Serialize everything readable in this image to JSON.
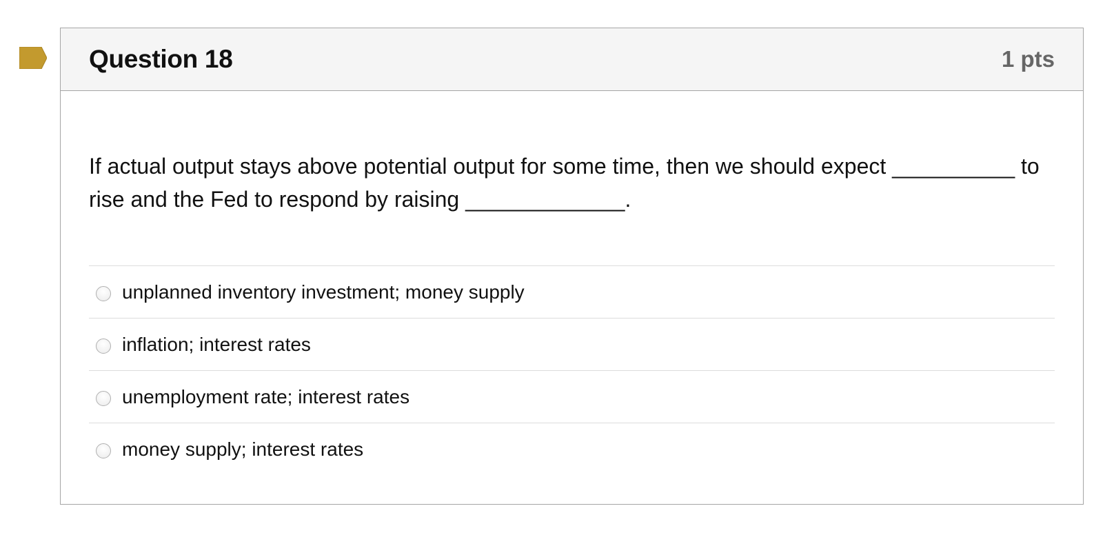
{
  "question": {
    "title": "Question 18",
    "points": "1 pts",
    "text": "If actual output stays above potential output for some time, then we should expect __________ to rise and the Fed to respond by raising _____________.",
    "answers": [
      {
        "label": "unplanned inventory investment; money supply"
      },
      {
        "label": "inflation; interest rates"
      },
      {
        "label": "unemployment rate; interest rates"
      },
      {
        "label": "money supply; interest rates"
      }
    ]
  },
  "colors": {
    "flag": "#c39a2e",
    "header_bg": "#f5f5f5",
    "border": "#a5a5a5"
  },
  "icons": {
    "flag": "flag-icon"
  }
}
